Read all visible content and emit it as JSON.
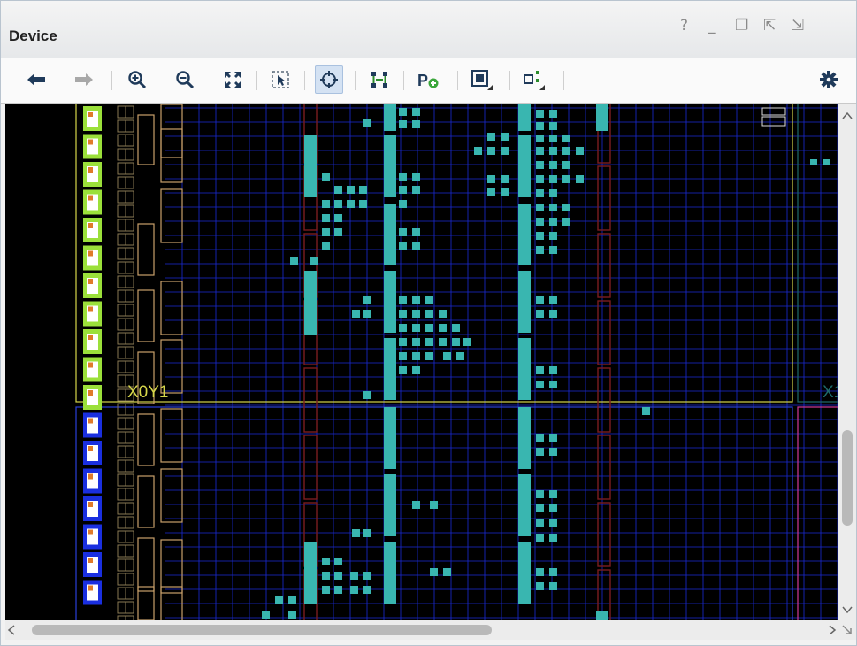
{
  "window": {
    "title": "Device",
    "controls": [
      "?",
      "_",
      "❐",
      "⇱",
      "⇲"
    ]
  },
  "toolbar": {
    "buttons": [
      {
        "name": "back-arrow-icon",
        "label": "Back",
        "enabled": true
      },
      {
        "name": "forward-arrow-icon",
        "label": "Forward",
        "enabled": false
      },
      {
        "name": "zoom-in-icon",
        "label": "Zoom In"
      },
      {
        "name": "zoom-out-icon",
        "label": "Zoom Out"
      },
      {
        "name": "zoom-fit-icon",
        "label": "Zoom Fit"
      },
      {
        "name": "zoom-selection-icon",
        "label": "Zoom to Selection"
      },
      {
        "name": "autofit-selection-icon",
        "label": "Auto-fit Selection",
        "active": true
      },
      {
        "name": "routing-resources-icon",
        "label": "Routing Resources"
      },
      {
        "name": "add-pblock-icon",
        "label": "P+"
      },
      {
        "name": "draw-pblock-icon",
        "label": "Draw Pblock"
      },
      {
        "name": "route-view-icon",
        "label": "Route View"
      },
      {
        "name": "settings-gear-icon",
        "label": "Settings"
      }
    ]
  },
  "device_view": {
    "clock_region_labels": [
      "X0Y1",
      "X1"
    ]
  },
  "colors": {
    "background": "#000000",
    "grid": "#1b2bd6",
    "slice": "#39b6b0",
    "clock_region_border": "#d6d64a",
    "io_green": "#9be03a",
    "io_blue": "#1a2fe0",
    "bram_outline": "#c9a06a",
    "dsp_outline": "#7a1c20"
  }
}
